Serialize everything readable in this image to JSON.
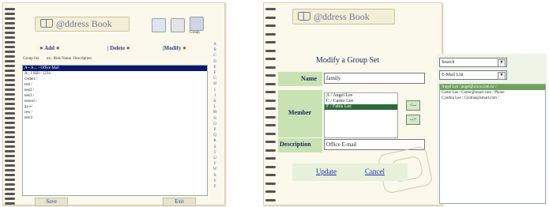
{
  "left_panel": {
    "app_title": "@ddress Book",
    "toolbar_icons": [
      {
        "icon": "tag-icon",
        "label": ""
      },
      {
        "icon": "folder-icon",
        "label": ""
      },
      {
        "icon": "group-icon",
        "label": "Group"
      }
    ],
    "actions": {
      "add": "Add",
      "delete": "Delete",
      "modify": "Modify"
    },
    "list_header": "Group list        ex.: Risk Name  Description",
    "list_items": [
      {
        "text": "A-- A.... / Office Mail",
        "selected": true
      },
      {
        "text": "A_ 1 Hill / 1234",
        "selected": false
      },
      {
        "text": "Orders /",
        "selected": false
      },
      {
        "text": "test /",
        "selected": false
      },
      {
        "text": "test2 /",
        "selected": false
      },
      {
        "text": "test3 /",
        "selected": false
      },
      {
        "text": "testcel /",
        "selected": false
      },
      {
        "text": "gu e/",
        "selected": false
      },
      {
        "text": "rew /",
        "selected": false
      },
      {
        "text": "test1/",
        "selected": false
      }
    ],
    "alphabet": [
      "A",
      "B",
      "C",
      "D",
      "E",
      "F",
      "G",
      "H",
      "I",
      "J",
      "K",
      "L",
      "M",
      "N",
      "O",
      "P",
      "Q",
      "R",
      "S",
      "T",
      "U",
      "V",
      "W",
      "X",
      "Y",
      "Z"
    ],
    "footer": {
      "left_button": "Save",
      "right_button": "Exit"
    }
  },
  "right_panel": {
    "app_title": "@ddress Book",
    "form_title": "Modify a Group Set",
    "name_label": "Name",
    "name_value": "family",
    "member_label": "Member",
    "members": [
      {
        "text": "A / Angel Lee",
        "selected": false
      },
      {
        "text": "C / Carter Lee",
        "selected": false
      },
      {
        "text": "F / Fabia Lee",
        "selected": true
      }
    ],
    "add_arrow": "<--",
    "remove_arrow": "-->",
    "description_label": "Description",
    "description_value": "Office E-mail",
    "update_label": "Update",
    "cancel_label": "Cancel",
    "search_select": "Search",
    "filter_select": "E-Mail List",
    "contacts": [
      {
        "text": "Angel Lee / angel@www.com.tw /",
        "selected": true
      },
      {
        "text": "Carter Lee / Carter@smart.com / Phone",
        "selected": false
      },
      {
        "text": "Cynthia Lee / Cynthia@smart.com /",
        "selected": false
      }
    ]
  }
}
